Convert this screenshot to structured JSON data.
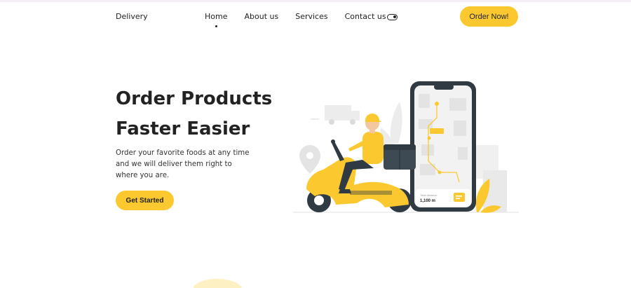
{
  "header": {
    "logo": "Delivery",
    "nav": [
      "Home",
      "About us",
      "Services",
      "Contact us"
    ],
    "active_nav": "Home",
    "order_button": "Order Now!"
  },
  "hero": {
    "title_line1": "Order Products",
    "title_line2": "Faster Easier",
    "description": "Order your favorite foods at any time and we will deliver them right to where you are.",
    "cta": "Get Started"
  },
  "phone": {
    "total_label": "Total distance",
    "distance": "1,100 m"
  },
  "colors": {
    "accent": "#fbc92f",
    "text": "#222222",
    "phone_frame": "#2f3a42"
  },
  "icons": [
    "theme-toggle-icon",
    "location-pin-icon",
    "truck-icon",
    "chat-icon"
  ]
}
